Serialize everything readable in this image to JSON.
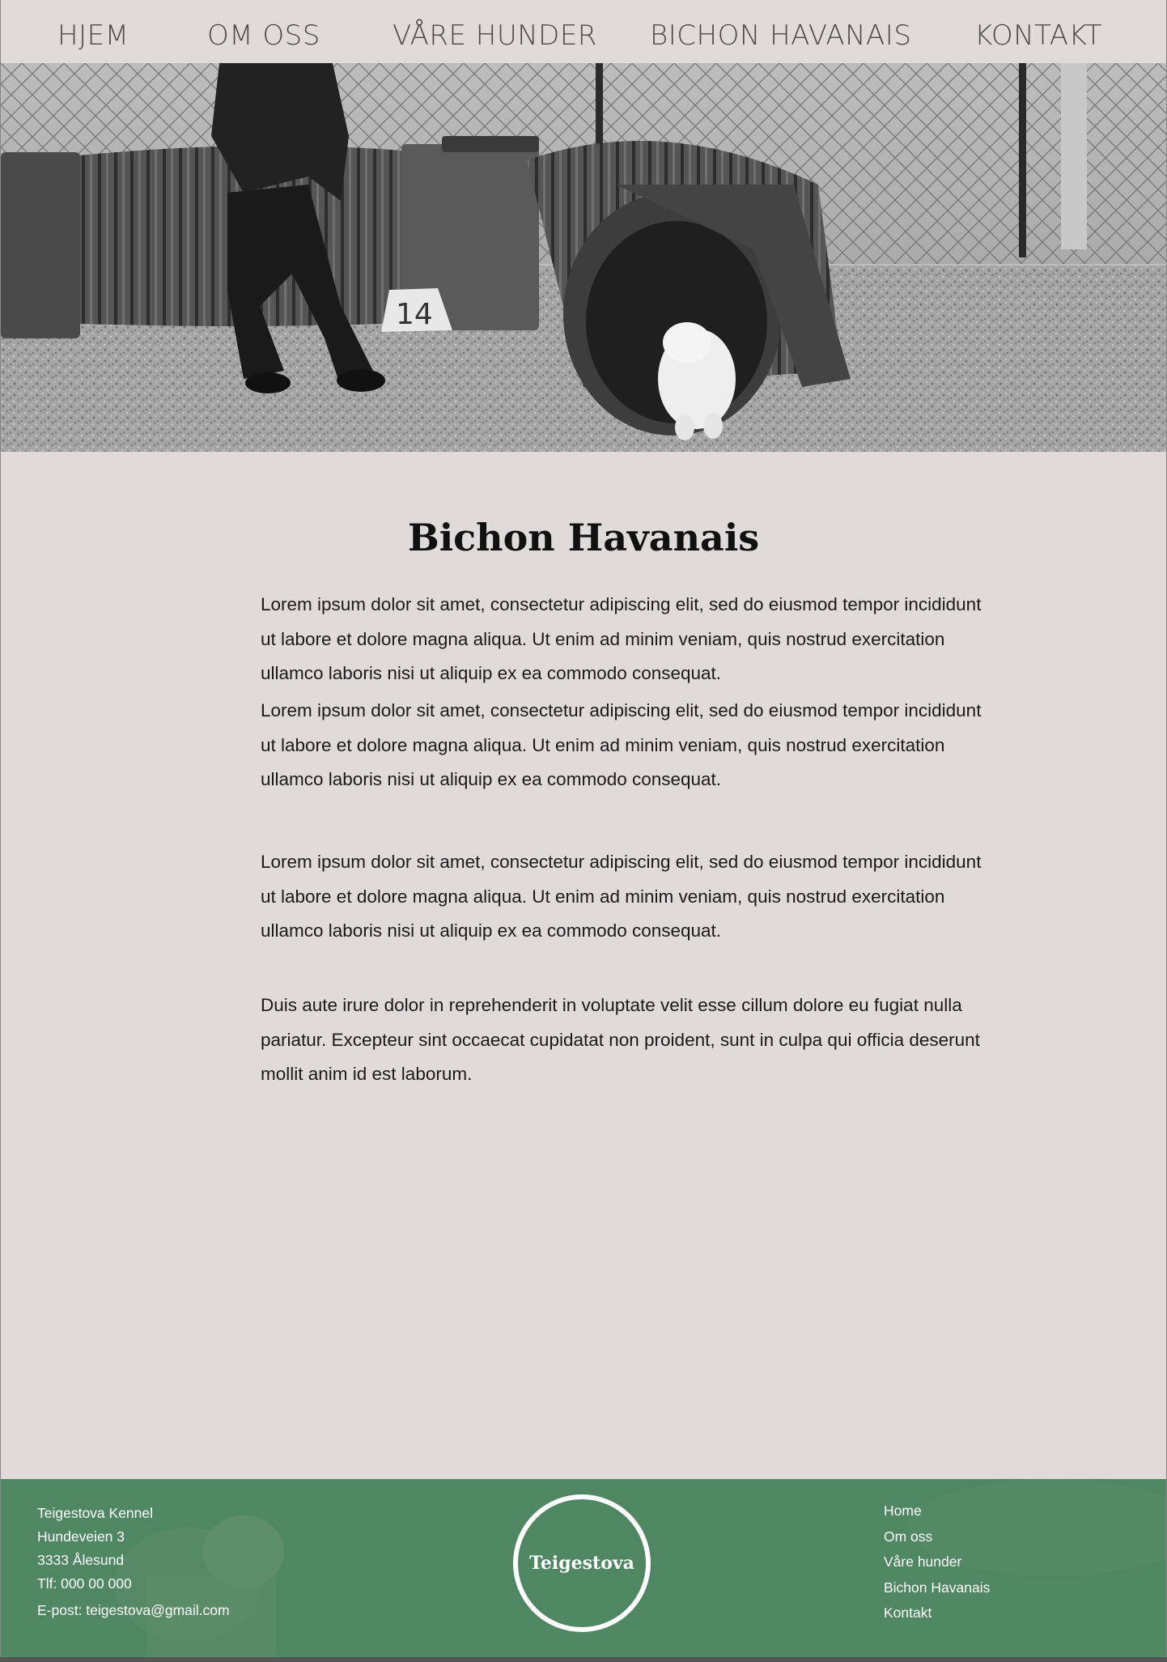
{
  "nav": {
    "items": [
      {
        "label": "HJEM"
      },
      {
        "label": "OM OSS"
      },
      {
        "label": "VÅRE HUNDER"
      },
      {
        "label": "BICHON HAVANAIS"
      },
      {
        "label": "KONTAKT"
      }
    ]
  },
  "hero": {
    "tunnel_number": "14"
  },
  "main": {
    "title": "Bichon Havanais",
    "paragraphs": [
      "Lorem ipsum dolor sit amet, consectetur adipiscing elit, sed do eiusmod tempor incididunt ut labore et dolore magna aliqua. Ut enim ad minim veniam, quis nostrud exercitation ullamco laboris nisi ut aliquip ex ea commodo consequat.",
      "Lorem ipsum dolor sit amet, consectetur adipiscing elit, sed do eiusmod tempor incididunt ut labore et dolore magna aliqua. Ut enim ad minim veniam, quis nostrud exercitation ullamco laboris nisi ut aliquip ex ea commodo consequat.",
      "Lorem ipsum dolor sit amet, consectetur adipiscing elit, sed do eiusmod tempor incididunt ut labore et dolore magna aliqua. Ut enim ad minim veniam, quis nostrud exercitation ullamco laboris nisi ut aliquip ex ea commodo consequat.",
      "Duis aute irure dolor in reprehenderit in voluptate velit esse cillum dolore eu fugiat nulla pariatur. Excepteur sint occaecat cupidatat non proident, sunt in culpa qui officia deserunt mollit anim id est laborum."
    ]
  },
  "footer": {
    "address": {
      "name": "Teigestova Kennel",
      "street": "Hundeveien 3",
      "city": "3333 Ålesund",
      "phone": "Tlf: 000 00 000",
      "email": "E-post: teigestova@gmail.com"
    },
    "logo_text": "Teigestova",
    "links": [
      {
        "label": "Home"
      },
      {
        "label": "Om oss"
      },
      {
        "label": "Våre hunder"
      },
      {
        "label": "Bichon Havanais"
      },
      {
        "label": "Kontakt"
      }
    ]
  },
  "colors": {
    "page_bg": "#e0dbdb",
    "footer_bg": "#4e8762",
    "nav_text": "#4a4a4a",
    "body_text": "#1a1a1a"
  }
}
